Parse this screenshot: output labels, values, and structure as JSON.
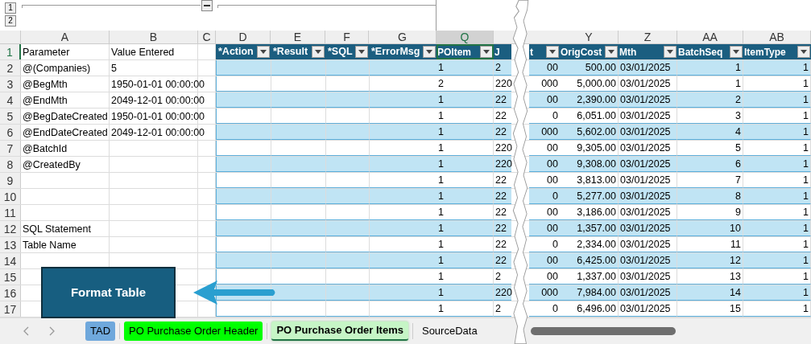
{
  "outline": {
    "levels": [
      "1",
      "2"
    ]
  },
  "column_letters": [
    {
      "letter": "A",
      "selected": false
    },
    {
      "letter": "B",
      "selected": false
    },
    {
      "letter": "C",
      "selected": false
    },
    {
      "letter": "D",
      "selected": false
    },
    {
      "letter": "E",
      "selected": false
    },
    {
      "letter": "F",
      "selected": false
    },
    {
      "letter": "G",
      "selected": false
    },
    {
      "letter": "Q",
      "selected": true
    },
    {
      "letter": "Y",
      "selected": false
    },
    {
      "letter": "Z",
      "selected": false
    },
    {
      "letter": "AA",
      "selected": false
    },
    {
      "letter": "AB",
      "selected": false
    }
  ],
  "left_table": {
    "headers": [
      "*Action",
      "*Result",
      "*SQL",
      "*ErrorMsg"
    ]
  },
  "right_table": {
    "columns": [
      {
        "heading": "POItem",
        "kind": "left",
        "selected": true
      },
      {
        "heading": "J",
        "kind": "cut-left",
        "selected": false
      },
      {
        "heading": "t",
        "kind": "cut-right",
        "selected": false
      },
      {
        "heading": "OrigCost",
        "kind": "right",
        "selected": false
      },
      {
        "heading": "Mth",
        "kind": "left",
        "selected": false
      },
      {
        "heading": "BatchSeq",
        "kind": "right",
        "selected": false
      },
      {
        "heading": "ItemType",
        "kind": "right",
        "selected": false
      }
    ]
  },
  "rows": [
    {
      "number": "1",
      "selected": true,
      "parameter": "Parameter",
      "value": "Value Entered"
    },
    {
      "number": "2",
      "selected": false,
      "parameter": "@(Companies)",
      "value": "5",
      "cells": [
        "1",
        "2",
        "00",
        "500.00",
        "03/01/2025",
        "1",
        "1"
      ]
    },
    {
      "number": "3",
      "selected": false,
      "parameter": "@BegMth",
      "value": "1950-01-01 00:00:00",
      "cells": [
        "2",
        "220",
        "000",
        "5,000.00",
        "03/01/2025",
        "1",
        "1"
      ]
    },
    {
      "number": "4",
      "selected": false,
      "parameter": "@EndMth",
      "value": "2049-12-01 00:00:00",
      "cells": [
        "1",
        "22",
        "00",
        "2,390.00",
        "03/01/2025",
        "2",
        "1"
      ]
    },
    {
      "number": "5",
      "selected": false,
      "parameter": "@BegDateCreated",
      "value": "1950-01-01 00:00:00",
      "cells": [
        "1",
        "22",
        "0",
        "6,051.00",
        "03/01/2025",
        "3",
        "1"
      ]
    },
    {
      "number": "6",
      "selected": false,
      "parameter": "@EndDateCreated",
      "value": "2049-12-01 00:00:00",
      "cells": [
        "1",
        "22",
        "000",
        "5,602.00",
        "03/01/2025",
        "4",
        "1"
      ]
    },
    {
      "number": "7",
      "selected": false,
      "parameter": "@BatchId",
      "cells": [
        "1",
        "220",
        "00",
        "9,305.00",
        "03/01/2025",
        "5",
        "1"
      ]
    },
    {
      "number": "8",
      "selected": false,
      "parameter": "@CreatedBy",
      "cells": [
        "1",
        "220",
        "00",
        "9,308.00",
        "03/01/2025",
        "6",
        "1"
      ]
    },
    {
      "number": "9",
      "selected": false,
      "cells": [
        "1",
        "22",
        "00",
        "3,813.00",
        "03/01/2025",
        "7",
        "1"
      ]
    },
    {
      "number": "10",
      "selected": false,
      "cells": [
        "1",
        "22",
        "0",
        "5,277.00",
        "03/01/2025",
        "8",
        "1"
      ]
    },
    {
      "number": "11",
      "selected": false,
      "cells": [
        "1",
        "22",
        "00",
        "3,186.00",
        "03/01/2025",
        "9",
        "1"
      ]
    },
    {
      "number": "12",
      "selected": false,
      "parameter": "SQL Statement",
      "cells": [
        "1",
        "22",
        "00",
        "1,357.00",
        "03/01/2025",
        "10",
        "1"
      ]
    },
    {
      "number": "13",
      "selected": false,
      "parameter": "Table Name",
      "cells": [
        "1",
        "22",
        "0",
        "2,334.00",
        "03/01/2025",
        "11",
        "1"
      ]
    },
    {
      "number": "14",
      "selected": false,
      "cells": [
        "1",
        "22",
        "00",
        "6,425.00",
        "03/01/2025",
        "12",
        "1"
      ]
    },
    {
      "number": "15",
      "selected": false,
      "cells": [
        "1",
        "2",
        "00",
        "1,337.00",
        "03/01/2025",
        "13",
        "1"
      ]
    },
    {
      "number": "16",
      "selected": false,
      "cells": [
        "1",
        "220",
        "000",
        "7,984.00",
        "03/01/2025",
        "14",
        "1"
      ]
    },
    {
      "number": "17",
      "selected": false,
      "cells": [
        "1",
        "2",
        "0",
        "6,496.00",
        "03/01/2025",
        "15",
        "1"
      ]
    }
  ],
  "format_button": {
    "label": "Format Table"
  },
  "sheet_tabs": [
    {
      "label": "TAD",
      "color": "#6fa8dc",
      "selected": false
    },
    {
      "label": "PO Purchase Order Header",
      "color": "#00ff00",
      "selected": false
    },
    {
      "label": "PO Purchase Order Items",
      "color": "#c6f5c6",
      "selected": true
    },
    {
      "label": "SourceData",
      "selected": false
    }
  ]
}
